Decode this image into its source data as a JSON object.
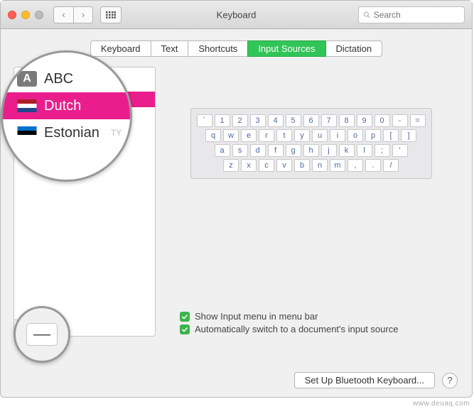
{
  "window": {
    "title": "Keyboard"
  },
  "toolbar": {
    "back": "‹",
    "forward": "›"
  },
  "search": {
    "placeholder": "Search"
  },
  "tabs": [
    {
      "label": "Keyboard",
      "active": false
    },
    {
      "label": "Text",
      "active": false
    },
    {
      "label": "Shortcuts",
      "active": false
    },
    {
      "label": "Input Sources",
      "active": true
    },
    {
      "label": "Dictation",
      "active": false
    }
  ],
  "sources": [
    {
      "name": "Dutch",
      "selected": true
    },
    {
      "name": "Estonian",
      "selected": false
    }
  ],
  "magnifier": {
    "items": [
      {
        "name": "ABC",
        "type": "abc"
      },
      {
        "name": "Dutch",
        "type": "nl",
        "selected": true
      },
      {
        "name": "Estonian",
        "type": "ee"
      }
    ],
    "truncated_text": "TY"
  },
  "keyboard_rows": [
    [
      "`",
      "1",
      "2",
      "3",
      "4",
      "5",
      "6",
      "7",
      "8",
      "9",
      "0",
      "-",
      "="
    ],
    [
      "q",
      "w",
      "e",
      "r",
      "t",
      "y",
      "u",
      "i",
      "o",
      "p",
      "[",
      "]"
    ],
    [
      "a",
      "s",
      "d",
      "f",
      "g",
      "h",
      "j",
      "k",
      "l",
      ";",
      "'"
    ],
    [
      "z",
      "x",
      "c",
      "v",
      "b",
      "n",
      "m",
      ",",
      ".",
      "/"
    ]
  ],
  "checkboxes": {
    "show_menu": "Show Input menu in menu bar",
    "auto_switch": "Automatically switch to a document's input source"
  },
  "add_remove": {
    "add": "+",
    "remove": "−"
  },
  "minus_mag": "—",
  "bottom": {
    "setup": "Set Up Bluetooth Keyboard...",
    "help": "?"
  },
  "watermark": "www.deuaq.com"
}
